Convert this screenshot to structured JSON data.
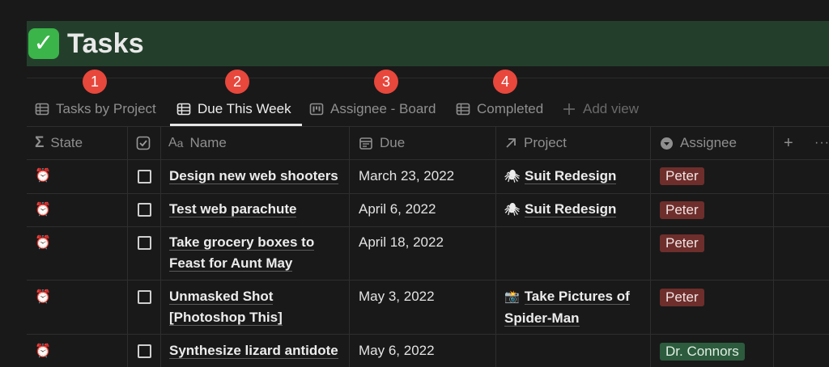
{
  "page": {
    "title": "Tasks",
    "title_icon": "check-mark-button-emoji"
  },
  "badges": [
    "1",
    "2",
    "3",
    "4"
  ],
  "tabs": [
    {
      "label": "Tasks by Project",
      "icon": "table-icon",
      "active": false
    },
    {
      "label": "Due This Week",
      "icon": "table-icon",
      "active": true
    },
    {
      "label": "Assignee - Board",
      "icon": "board-icon",
      "active": false
    },
    {
      "label": "Completed",
      "icon": "table-icon",
      "active": false
    },
    {
      "label": "Add view",
      "icon": "plus-icon",
      "active": false
    }
  ],
  "columns": [
    {
      "label": "State",
      "icon": "sigma-icon"
    },
    {
      "label": "",
      "icon": "checkbox-icon"
    },
    {
      "label": "Name",
      "icon": "text-aa-icon"
    },
    {
      "label": "Due",
      "icon": "calendar-icon"
    },
    {
      "label": "Project",
      "icon": "arrow-up-right-icon"
    },
    {
      "label": "Assignee",
      "icon": "select-icon"
    }
  ],
  "header_actions": {
    "add": "+",
    "more": "···"
  },
  "rows": [
    {
      "state_icon": "alarm-clock-emoji",
      "checked": false,
      "name_lines": [
        "Design new web shooters"
      ],
      "due": "March 23, 2022",
      "project_icon": "spider-emoji",
      "project_lines": [
        "Suit Redesign"
      ],
      "assignee": "Peter",
      "assignee_color": "#6e2e2b"
    },
    {
      "state_icon": "alarm-clock-emoji",
      "checked": false,
      "name_lines": [
        "Test web parachute"
      ],
      "due": "April 6, 2022",
      "project_icon": "spider-emoji",
      "project_lines": [
        "Suit Redesign"
      ],
      "assignee": "Peter",
      "assignee_color": "#6e2e2b"
    },
    {
      "state_icon": "alarm-clock-emoji",
      "checked": false,
      "name_lines": [
        "Take grocery boxes to",
        "Feast for Aunt May"
      ],
      "due": "April 18, 2022",
      "project_icon": "",
      "project_lines": [],
      "assignee": "Peter",
      "assignee_color": "#6e2e2b"
    },
    {
      "state_icon": "alarm-clock-emoji",
      "checked": false,
      "name_lines": [
        "Unmasked Shot",
        "[Photoshop This]"
      ],
      "due": "May 3, 2022",
      "project_icon": "camera-flash-emoji",
      "project_lines": [
        "Take Pictures of",
        "Spider-Man"
      ],
      "assignee": "Peter",
      "assignee_color": "#6e2e2b"
    },
    {
      "state_icon": "alarm-clock-emoji",
      "checked": false,
      "name_lines": [
        "Synthesize lizard antidote"
      ],
      "due": "May 6, 2022",
      "project_icon": "",
      "project_lines": [],
      "assignee": "Dr. Connors",
      "assignee_color": "#2c5b3d"
    }
  ],
  "colors": {
    "background": "#191919",
    "title_bar": "#233f2b",
    "badge": "#e8473c"
  }
}
